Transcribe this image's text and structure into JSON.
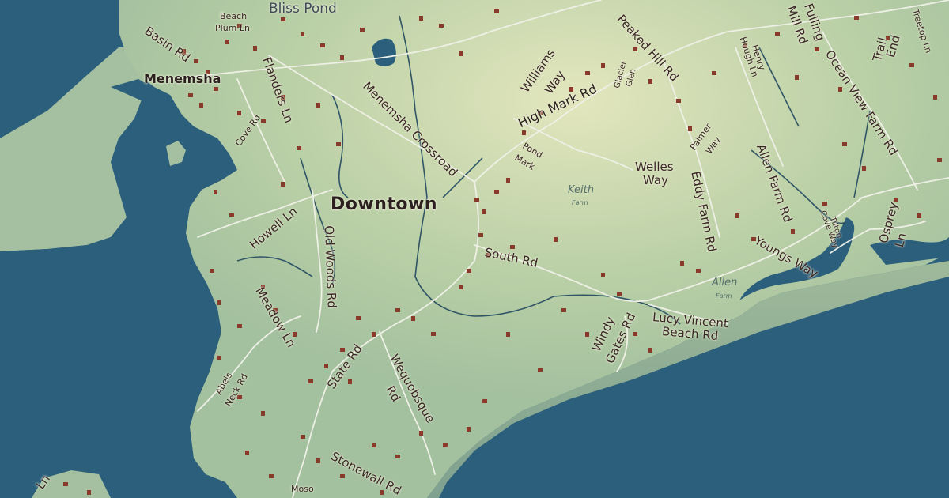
{
  "map": {
    "colors": {
      "water": "#2c5f7c",
      "land": "#a9c4a2",
      "land_highlight": "#d9e2b4",
      "road": "#e8ece0",
      "stream": "#2f5566",
      "building": "#8a3a2a"
    },
    "labels": {
      "town": "Downtown",
      "village": "Menemsha",
      "bliss_pond": "Bliss Pond",
      "keith": "Keith",
      "keith_sub": "Farm",
      "allen": "Allen",
      "allen_sub": "Farm",
      "basin_rd": "Basin Rd",
      "beach_plum_1": "Beach",
      "beach_plum_2": "Plum Ln",
      "flanders_ln": "Flanders Ln",
      "cove_rd": "Cove Rd",
      "menemsha_crossroad": "Menemsha Crossroad",
      "williams_1": "Williams",
      "williams_2": "Way",
      "high_mark_rd": "High Mark Rd",
      "glacier_1": "Glacier",
      "glacier_2": "Glen",
      "peaked_hill_rd": "Peaked Hill Rd",
      "pond_1": "Pond",
      "pond_2": "Mark",
      "palmer_1": "Palmer",
      "palmer_2": "Way",
      "welles_1": "Welles",
      "welles_2": "Way",
      "eddy_farm_rd": "Eddy Farm Rd",
      "henry_1": "Henry",
      "henry_2": "Hough Ln",
      "fulling_1": "Fulling",
      "fulling_2": "Mill Rd",
      "ocean_view_farm_rd": "Ocean View Farm Rd",
      "trail_1": "Trail",
      "trail_2": "End",
      "treetop_ln": "Treetop Ln",
      "allen_farm_rd": "Allen Farm Rd",
      "tilton_1": "Tilton",
      "tilton_2": "Cove Way",
      "osprey_1": "Osprey",
      "osprey_2": "Ln",
      "youngs_way": "Youngs Way",
      "howell_ln": "Howell Ln",
      "old_woods_rd": "Old Woods Rd",
      "south_rd": "South Rd",
      "meadow_ln": "Meadow Ln",
      "state_rd": "State Rd",
      "abels_1": "Abels",
      "abels_2": "Neck Rd",
      "wequobsque_1": "Wequobsque",
      "wequobsque_2": "Rd",
      "windy_1": "Windy",
      "windy_2": "Gates Rd",
      "lucy_1": "Lucy Vincent",
      "lucy_2": "Beach Rd",
      "stonewall_rd": "Stonewall Rd",
      "ln_left": "Ln",
      "moso": "Moso"
    }
  }
}
